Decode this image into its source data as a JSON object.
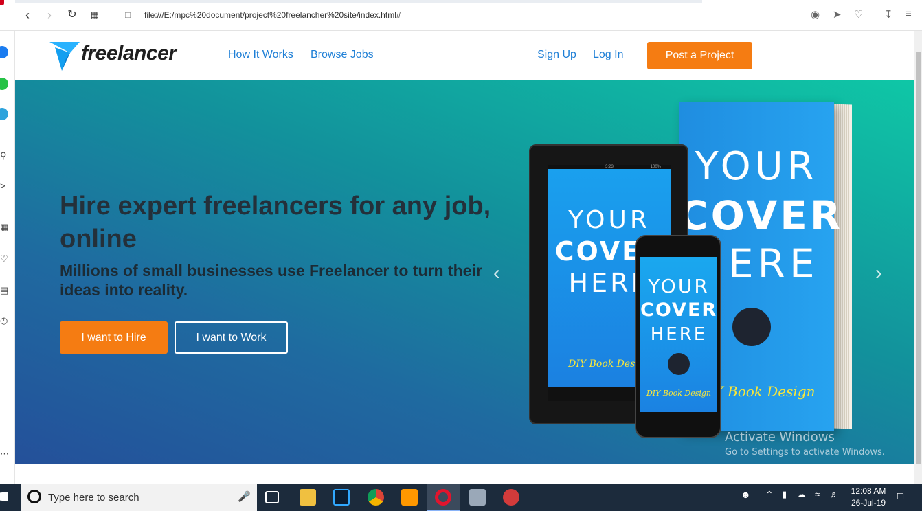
{
  "browser": {
    "url": "file:///E:/mpc%20document/project%20freelancher%20site/index.html#"
  },
  "site": {
    "logo_text": "freelancer",
    "nav": {
      "how_it_works": "How It Works",
      "browse_jobs": "Browse Jobs",
      "sign_up": "Sign Up",
      "log_in": "Log In",
      "post_project": "Post a Project"
    },
    "hero": {
      "title": "Hire expert freelancers for any job, online",
      "subtitle": "Millions of small businesses use Freelancer to turn their ideas into reality.",
      "hire_button": "I want to Hire",
      "work_button": "I want to Work",
      "prev_arrow": "‹",
      "next_arrow": "›"
    },
    "cover": {
      "line1": "YOUR",
      "line2": "COVER",
      "line3": "HERE",
      "brand": "DIY Book Design",
      "status_time": "3:23",
      "status_battery": "100%"
    }
  },
  "watermark": {
    "title": "Activate Windows",
    "subtitle": "Go to Settings to activate Windows."
  },
  "taskbar": {
    "search_placeholder": "Type here to search",
    "time": "12:08 AM",
    "date": "26-Jul-19"
  },
  "colors": {
    "brand_orange": "#f57c12",
    "link_blue": "#1e7fd6"
  }
}
